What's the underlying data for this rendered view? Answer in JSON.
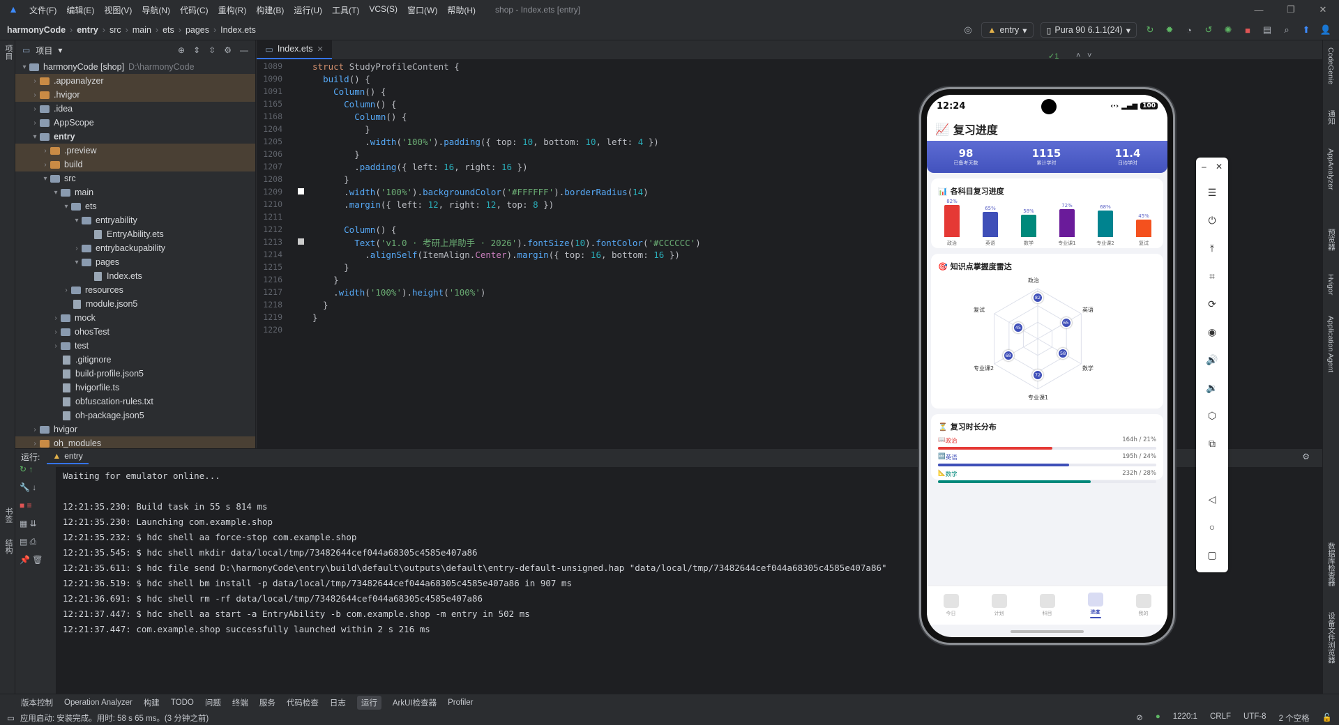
{
  "titlebar": {
    "menus": [
      "文件(F)",
      "编辑(E)",
      "视图(V)",
      "导航(N)",
      "代码(C)",
      "重构(R)",
      "构建(B)",
      "运行(U)",
      "工具(T)",
      "VCS(S)",
      "窗口(W)",
      "帮助(H)"
    ],
    "window_title": "shop - Index.ets [entry]"
  },
  "breadcrumb": [
    "harmonyCode",
    "entry",
    "src",
    "main",
    "ets",
    "pages",
    "Index.ets"
  ],
  "run_config": {
    "module": "entry",
    "device": "Pura 90 6.1.1(24)"
  },
  "project_panel": {
    "title": "项目",
    "tree": [
      {
        "label": "harmonyCode [shop]",
        "hint": "D:\\harmonyCode",
        "indent": 0,
        "type": "folder",
        "open": true
      },
      {
        "label": ".appanalyzer",
        "indent": 1,
        "type": "folder-orange",
        "hl": true
      },
      {
        "label": ".hvigor",
        "indent": 1,
        "type": "folder-orange",
        "hl": true
      },
      {
        "label": ".idea",
        "indent": 1,
        "type": "folder"
      },
      {
        "label": "AppScope",
        "indent": 1,
        "type": "folder"
      },
      {
        "label": "entry",
        "indent": 1,
        "type": "folder",
        "open": true,
        "bold": true
      },
      {
        "label": ".preview",
        "indent": 2,
        "type": "folder-orange",
        "hl": true
      },
      {
        "label": "build",
        "indent": 2,
        "type": "folder-orange",
        "hl": true
      },
      {
        "label": "src",
        "indent": 2,
        "type": "folder",
        "open": true
      },
      {
        "label": "main",
        "indent": 3,
        "type": "folder",
        "open": true
      },
      {
        "label": "ets",
        "indent": 4,
        "type": "folder",
        "open": true
      },
      {
        "label": "entryability",
        "indent": 5,
        "type": "folder",
        "open": true
      },
      {
        "label": "EntryAbility.ets",
        "indent": 6,
        "type": "file"
      },
      {
        "label": "entrybackupability",
        "indent": 5,
        "type": "folder"
      },
      {
        "label": "pages",
        "indent": 5,
        "type": "folder",
        "open": true
      },
      {
        "label": "Index.ets",
        "indent": 6,
        "type": "file"
      },
      {
        "label": "resources",
        "indent": 4,
        "type": "folder"
      },
      {
        "label": "module.json5",
        "indent": 4,
        "type": "file"
      },
      {
        "label": "mock",
        "indent": 3,
        "type": "folder"
      },
      {
        "label": "ohosTest",
        "indent": 3,
        "type": "folder"
      },
      {
        "label": "test",
        "indent": 3,
        "type": "folder"
      },
      {
        "label": ".gitignore",
        "indent": 3,
        "type": "file"
      },
      {
        "label": "build-profile.json5",
        "indent": 3,
        "type": "file"
      },
      {
        "label": "hvigorfile.ts",
        "indent": 3,
        "type": "file"
      },
      {
        "label": "obfuscation-rules.txt",
        "indent": 3,
        "type": "file"
      },
      {
        "label": "oh-package.json5",
        "indent": 3,
        "type": "file"
      },
      {
        "label": "hvigor",
        "indent": 1,
        "type": "folder"
      },
      {
        "label": "oh_modules",
        "indent": 1,
        "type": "folder-orange",
        "hl": true
      }
    ]
  },
  "editor": {
    "tab": "Index.ets",
    "inspection": "✓1",
    "lines": [
      {
        "n": "1089",
        "html": "<span class='kw'>struct</span> <span class='cls'>StudyProfileContent</span> {"
      },
      {
        "n": "1090",
        "html": "  <span class='fn'>build</span>() {"
      },
      {
        "n": "1091",
        "html": "    <span class='fn'>Column</span>() {"
      },
      {
        "n": "1165",
        "html": "      <span class='fn'>Column</span>() {"
      },
      {
        "n": "1168",
        "html": "        <span class='fn'>Column</span>() {"
      },
      {
        "n": "1204",
        "html": "          }"
      },
      {
        "n": "1205",
        "html": "          .<span class='fn'>width</span>(<span class='str'>'100%'</span>).<span class='fn'>padding</span>({ top: <span class='num'>10</span>, bottom: <span class='num'>10</span>, left: <span class='num'>4</span> })"
      },
      {
        "n": "1206",
        "html": "        }"
      },
      {
        "n": "1207",
        "html": "        .<span class='fn'>padding</span>({ left: <span class='num'>16</span>, right: <span class='num'>16</span> })"
      },
      {
        "n": "1208",
        "html": "      }"
      },
      {
        "n": "1209",
        "html": "      .<span class='fn'>width</span>(<span class='str'>'100%'</span>).<span class='fn'>backgroundColor</span>(<span class='str'>'#FFFFFF'</span>).<span class='fn'>borderRadius</span>(<span class='num'>14</span>)"
      },
      {
        "n": "1210",
        "html": "      .<span class='fn'>margin</span>({ left: <span class='num'>12</span>, right: <span class='num'>12</span>, top: <span class='num'>8</span> })"
      },
      {
        "n": "1211",
        "html": ""
      },
      {
        "n": "1212",
        "html": "      <span class='fn'>Column</span>() {"
      },
      {
        "n": "1213",
        "html": "        <span class='fn'>Text</span>(<span class='str'>'v1.0 · 考研上岸助手 · 2026'</span>).<span class='fn'>fontSize</span>(<span class='num'>10</span>).<span class='fn'>fontColor</span>(<span class='str'>'#CCCCCC'</span>)"
      },
      {
        "n": "1214",
        "html": "          .<span class='fn'>alignSelf</span>(<span class='cls'>ItemAlign</span>.<span class='ty'>Center</span>).<span class='fn'>margin</span>({ top: <span class='num'>16</span>, bottom: <span class='num'>16</span> })"
      },
      {
        "n": "1215",
        "html": "      }"
      },
      {
        "n": "1216",
        "html": "    }"
      },
      {
        "n": "1217",
        "html": "    .<span class='fn'>width</span>(<span class='str'>'100%'</span>).<span class='fn'>height</span>(<span class='str'>'100%'</span>)"
      },
      {
        "n": "1218",
        "html": "  }"
      },
      {
        "n": "1219",
        "html": "}"
      },
      {
        "n": "1220",
        "html": ""
      }
    ]
  },
  "run_panel": {
    "label": "运行:",
    "tab": "entry",
    "console": [
      "Waiting for emulator online...",
      "",
      "12:21:35.230: Build task in 55 s 814 ms",
      "12:21:35.230: Launching com.example.shop",
      "12:21:35.232: $ hdc shell aa force-stop com.example.shop",
      "12:21:35.545: $ hdc shell mkdir data/local/tmp/73482644cef044a68305c4585e407a86",
      "12:21:35.611: $ hdc file send D:\\harmonyCode\\entry\\build\\default\\outputs\\default\\entry-default-unsigned.hap \"data/local/tmp/73482644cef044a68305c4585e407a86\"",
      "12:21:36.519: $ hdc shell bm install -p data/local/tmp/73482644cef044a68305c4585e407a86 in 907 ms",
      "12:21:36.691: $ hdc shell rm -rf data/local/tmp/73482644cef044a68305c4585e407a86",
      "12:21:37.447: $ hdc shell aa start -a EntryAbility -b com.example.shop -m entry in 502 ms",
      "12:21:37.447: com.example.shop successfully launched within 2 s 216 ms"
    ]
  },
  "tool_windows": [
    "版本控制",
    "Operation Analyzer",
    "构建",
    "TODO",
    "问题",
    "终端",
    "服务",
    "代码检查",
    "日志",
    "运行",
    "ArkUI检查器",
    "Profiler"
  ],
  "status": {
    "message": "应用启动: 安装完成。用时: 58 s 65 ms。(3 分钟之前)",
    "position": "1220:1",
    "line_sep": "CRLF",
    "encoding": "UTF-8",
    "indent": "2 个空格"
  },
  "left_strip": [
    "项目",
    "书签",
    "结构"
  ],
  "right_strip": [
    "CodeGenie",
    "通知",
    "AppAnalyzer",
    "预览器",
    "Hvigor",
    "Application Agent",
    "数据库检查器",
    "设备文件浏览器"
  ],
  "phone": {
    "time": "12:24",
    "battery": "100",
    "app_title": "复习进度",
    "stats": [
      {
        "value": "98",
        "label": "已备考天数"
      },
      {
        "value": "1115",
        "label": "累计学时"
      },
      {
        "value": "11.4",
        "label": "日均学时"
      }
    ],
    "progress_title": "各科目复习进度",
    "radar_title": "知识点掌握度雷达",
    "dist_title": "复习时长分布",
    "subjects": [
      {
        "name": "政治",
        "pct": 82,
        "color": "#e53935"
      },
      {
        "name": "英语",
        "pct": 65,
        "color": "#3f4fb8"
      },
      {
        "name": "数学",
        "pct": 58,
        "color": "#00897b"
      },
      {
        "name": "专业课1",
        "pct": 72,
        "color": "#6a1b9a"
      },
      {
        "name": "专业课2",
        "pct": 68,
        "color": "#00838f"
      },
      {
        "name": "复试",
        "pct": 45,
        "color": "#f4511e"
      }
    ],
    "distribution": [
      {
        "name": "政治",
        "value": "164h / 21%",
        "pct": 21,
        "color": "#e53935",
        "icon": "📖"
      },
      {
        "name": "英语",
        "value": "195h / 24%",
        "pct": 24,
        "color": "#3f4fb8",
        "icon": "🔤"
      },
      {
        "name": "数学",
        "value": "232h / 28%",
        "pct": 28,
        "color": "#00897b",
        "icon": "📐"
      }
    ],
    "tabs": [
      {
        "label": "今日",
        "active": false
      },
      {
        "label": "计划",
        "active": false
      },
      {
        "label": "科目",
        "active": false
      },
      {
        "label": "进度",
        "active": true
      },
      {
        "label": "我的",
        "active": false
      }
    ]
  }
}
